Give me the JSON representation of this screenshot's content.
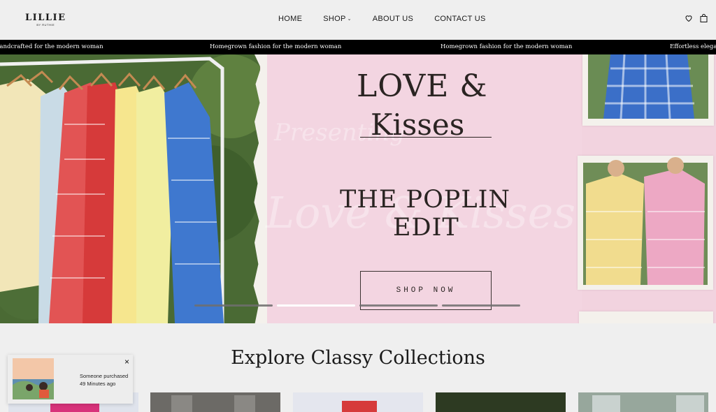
{
  "header": {
    "logo_main": "LILLIE",
    "logo_sub": "BY RUTHIE",
    "nav": [
      {
        "label": "HOME"
      },
      {
        "label": "SHOP",
        "has_dropdown": true
      },
      {
        "label": "ABOUT US"
      },
      {
        "label": "CONTACT US"
      }
    ],
    "icons": [
      "heart-icon",
      "shopping-bag-icon"
    ]
  },
  "marquee": {
    "items": [
      "Handcrafted for the modern woman",
      "Homegrown fashion for the modern woman",
      "Homegrown fashion for the modern woman",
      "Effortless elegance for"
    ]
  },
  "hero": {
    "title_line1": "LOVE &",
    "title_line2": "Kisses",
    "subtitle_line1": "THE POPLIN",
    "subtitle_line2": "EDIT",
    "script_word1": "Presenting",
    "script_word2": "Love & Kisses",
    "cta_label": "SHOP NOW",
    "slide_count": 4,
    "active_slide": 2,
    "colors": {
      "pink": "#f3d5e1",
      "text": "#2a2422"
    }
  },
  "collections": {
    "heading": "Explore Classy Collections"
  },
  "popup": {
    "line1": "Someone purchased",
    "line2": "49 Minutes ago",
    "close_label": "×"
  }
}
